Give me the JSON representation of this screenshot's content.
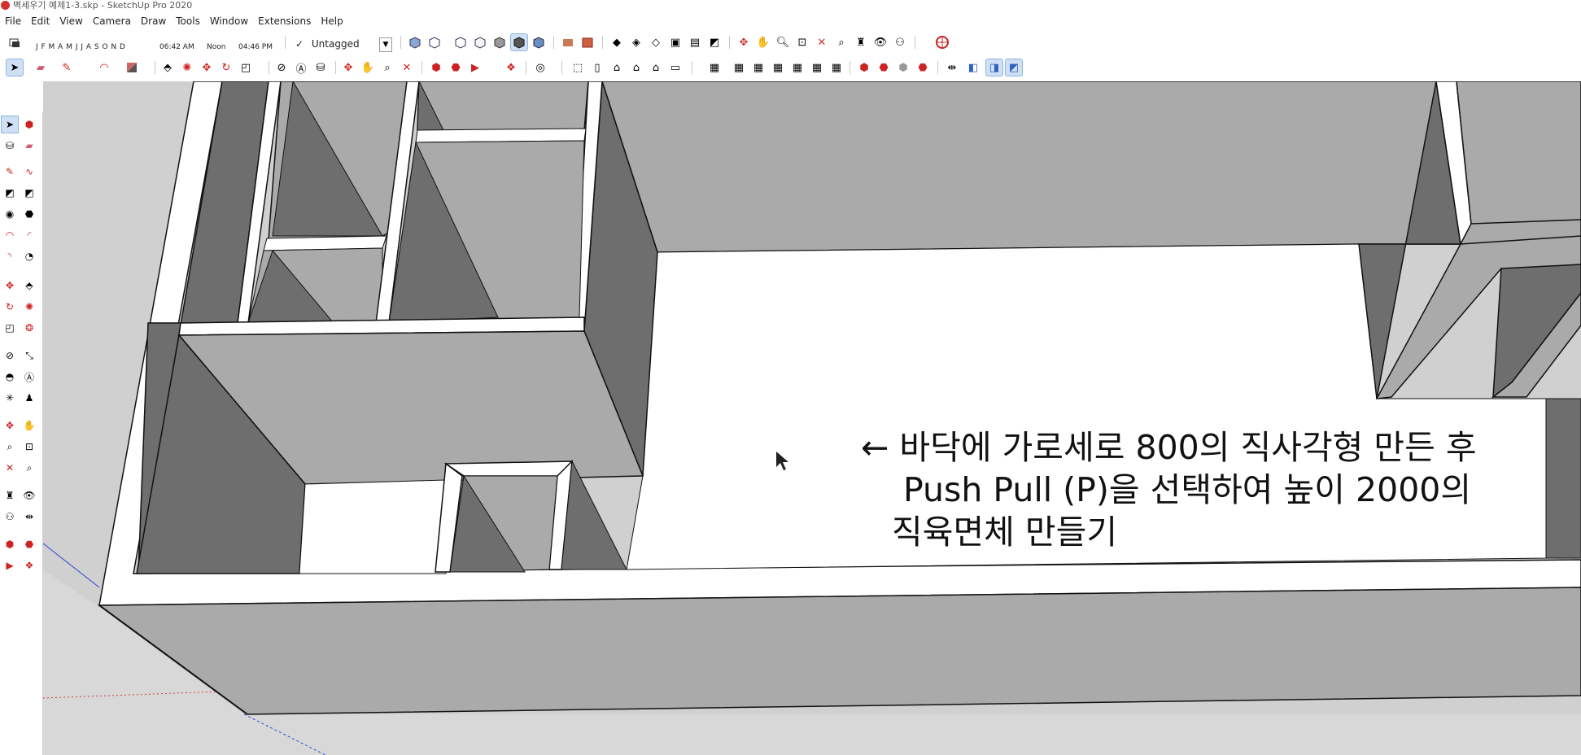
{
  "window": {
    "title": "벽세우기 예제1-3.skp - SketchUp Pro 2020"
  },
  "menu": [
    "File",
    "Edit",
    "View",
    "Camera",
    "Draw",
    "Tools",
    "Window",
    "Extensions",
    "Help"
  ],
  "shadows": {
    "months": "J F M A M J J A S O N D",
    "time_start": "06:42 AM",
    "time_mid": "Noon",
    "time_end": "04:46 PM"
  },
  "tag": {
    "check": "✓",
    "value": "Untagged"
  },
  "annotation": {
    "lines": [
      "← 바닥에 가로세로 800의 직사각형 만든 후",
      "Push Pull (P)을 선택하여 높이 2000의",
      "직육면체 만들기"
    ]
  },
  "colors": {
    "wall_top": "#ffffff",
    "wall_light": "#aaaaaa",
    "wall_dark": "#6e6e6e",
    "background": "#d0d0d0",
    "accent": "#d42f2f"
  }
}
